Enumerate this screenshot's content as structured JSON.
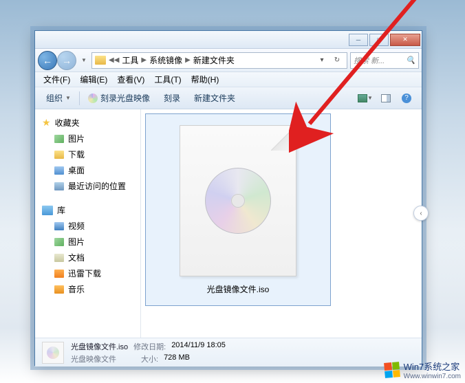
{
  "breadcrumb": [
    "工具",
    "系统镜像",
    "新建文件夹"
  ],
  "search_placeholder": "搜索 新...",
  "menus": [
    {
      "label": "文件(F)"
    },
    {
      "label": "编辑(E)"
    },
    {
      "label": "查看(V)"
    },
    {
      "label": "工具(T)"
    },
    {
      "label": "帮助(H)"
    }
  ],
  "toolbar": {
    "organize": "组织",
    "burn_image": "刻录光盘映像",
    "burn": "刻录",
    "new_folder": "新建文件夹"
  },
  "sidebar": {
    "favorites": {
      "header": "收藏夹",
      "items": [
        "图片",
        "下载",
        "桌面",
        "最近访问的位置"
      ]
    },
    "library": {
      "header": "库",
      "items": [
        "视频",
        "图片",
        "文档",
        "迅雷下载",
        "音乐"
      ]
    }
  },
  "file": {
    "name": "光盘镜像文件.iso"
  },
  "details": {
    "title": "光盘镜像文件.iso",
    "type": "光盘映像文件",
    "modified_label": "修改日期:",
    "modified_value": "2014/11/9 18:05",
    "size_label": "大小:",
    "size_value": "728 MB"
  },
  "watermark": {
    "title": "Win7系统之家",
    "url": "Www.winwin7.com"
  }
}
